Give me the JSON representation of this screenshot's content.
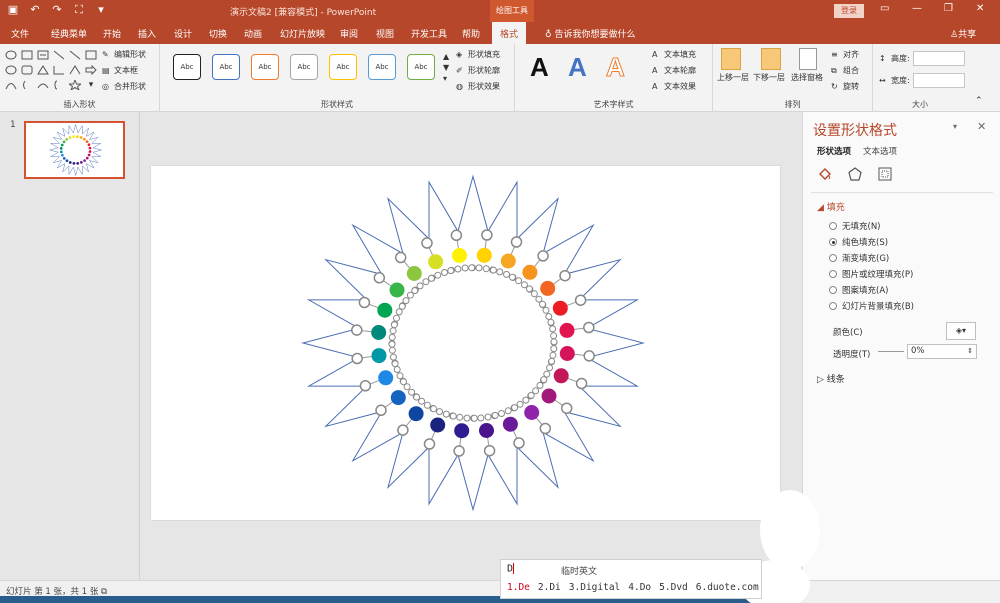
{
  "app": {
    "doc_title": "演示文稿2 [兼容模式] - PowerPoint",
    "context_tab_title": "绘图工具",
    "login_label": "登录"
  },
  "tabs": [
    "文件",
    "经典菜单",
    "开始",
    "插入",
    "设计",
    "切换",
    "动画",
    "幻灯片放映",
    "审阅",
    "视图",
    "开发工具",
    "帮助",
    "格式"
  ],
  "active_tab": "格式",
  "tell_me": "告诉我你想要做什么",
  "share_label": "共享",
  "ribbon": {
    "insert_shapes": {
      "label": "插入形状",
      "edit_shape": "编辑形状",
      "text_box": "文本框",
      "merge_shapes": "合并形状"
    },
    "shape_styles": {
      "label": "形状样式",
      "abc": "Abc",
      "style_colors": [
        "#222222",
        "#4472c4",
        "#ed7d31",
        "#a5a5a5",
        "#ffc000",
        "#5b9bd5",
        "#70ad47"
      ],
      "fill": "形状填充",
      "outline": "形状轮廓",
      "effects": "形状效果"
    },
    "wordart": {
      "label": "艺术字样式",
      "letter": "A",
      "text_fill": "文本填充",
      "text_outline": "文本轮廓",
      "text_effects": "文本效果"
    },
    "arrange": {
      "label": "排列",
      "bring_forward": "上移一层",
      "send_backward": "下移一层",
      "selection_pane": "选择窗格",
      "align": "对齐",
      "group": "组合",
      "rotate": "旋转"
    },
    "size": {
      "label": "大小",
      "height": "高度:",
      "width": "宽度:"
    }
  },
  "slide_pane": {
    "slide_number": "1"
  },
  "format_pane": {
    "title": "设置形状格式",
    "tab_shape": "形状选项",
    "tab_text": "文本选项",
    "fill_section": "填充",
    "fill_options": [
      "无填充(N)",
      "纯色填充(S)",
      "渐变填充(G)",
      "图片或纹理填充(P)",
      "图案填充(A)",
      "幻灯片背景填充(B)"
    ],
    "fill_selected_index": 1,
    "color_label": "颜色(C)",
    "transparency_label": "透明度(T)",
    "transparency_value": "0%",
    "line_section": "线条"
  },
  "status": {
    "text": "幻灯片 第 1 张，共 1 张"
  },
  "ime": {
    "composition": "D",
    "hint": "临时英文",
    "candidates": [
      "1.De",
      "2.Di",
      "3.Digital",
      "4.Do",
      "5.Dvd",
      "6.duote.com"
    ]
  },
  "colors": {
    "accent": "#b7472a",
    "wheel": [
      "#f5a623",
      "#f7941d",
      "#f26522",
      "#ed1c24",
      "#e2144f",
      "#d4145a",
      "#c2185b",
      "#a1197a",
      "#8e24aa",
      "#6a1b9a",
      "#4a148c",
      "#311b92",
      "#1a237e",
      "#0d47a1",
      "#1565c0",
      "#1e88e5",
      "#0097a7",
      "#00897b",
      "#00a651",
      "#39b54a",
      "#8dc63f",
      "#d7df23",
      "#fff200",
      "#ffd200"
    ]
  }
}
